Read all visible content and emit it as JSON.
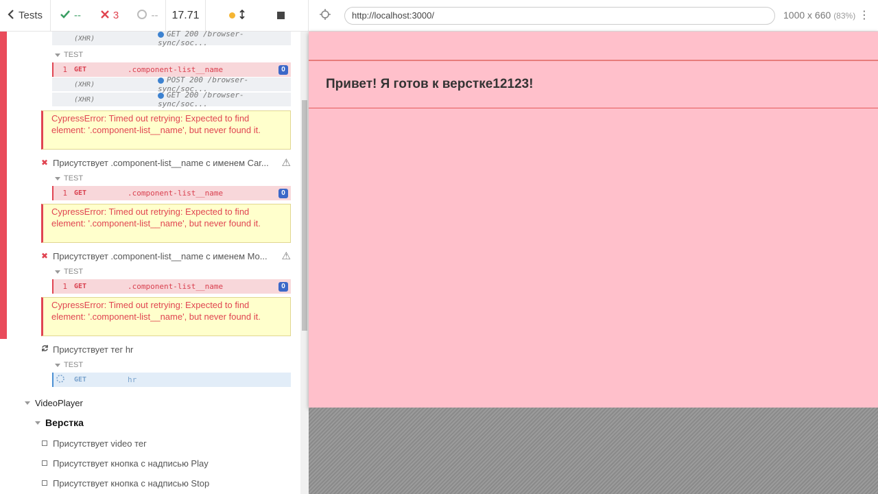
{
  "toolbar": {
    "tests_label": "Tests",
    "passed": "--",
    "failed": "3",
    "pending": "--",
    "duration": "17.71"
  },
  "commands": {
    "xhr1": {
      "type": "(XHR)",
      "msg": "GET 200 /browser-sync/soc..."
    },
    "hook1": "TEST",
    "get1": {
      "num": "1",
      "name": "GET",
      "msg": ".component-list__name",
      "count": "0"
    },
    "xhr2": {
      "type": "(XHR)",
      "msg": "POST 200 /browser-sync/soc..."
    },
    "xhr3": {
      "type": "(XHR)",
      "msg": "GET 200 /browser-sync/soc..."
    },
    "error1": "CypressError: Timed out retrying: Expected to find element: '.component-list__name', but never found it.",
    "test2": "Присутствует .component-list__name с именем Car...",
    "hook2": "TEST",
    "get2": {
      "num": "1",
      "name": "GET",
      "msg": ".component-list__name",
      "count": "0"
    },
    "error2": "CypressError: Timed out retrying: Expected to find element: '.component-list__name', but never found it.",
    "test3": "Присутствует .component-list__name с именем Mo...",
    "hook3": "TEST",
    "get3": {
      "num": "1",
      "name": "GET",
      "msg": ".component-list__name",
      "count": "0"
    },
    "error3": "CypressError: Timed out retrying: Expected to find element: '.component-list__name', but never found it.",
    "test4": "Присутствует тег hr",
    "hook4": "TEST",
    "get4": {
      "name": "GET",
      "msg": "hr"
    }
  },
  "suites": {
    "video_player": "VideoPlayer",
    "layout": "Верстка",
    "tests": [
      "Присутствует video тег",
      "Присутствует кнопка с надписью Play",
      "Присутствует кнопка с надписью Stop"
    ]
  },
  "aut": {
    "url": "http://localhost:3000/",
    "viewport": "1000 x 660",
    "scale": "(83%)",
    "heading": "Привет! Я готов к верстке12123!"
  },
  "colors": {
    "fail": "#e04451",
    "pass": "#3a9e63",
    "aut_bg": "#ffc0cb",
    "error_bg": "#ffffcc"
  },
  "icons": [
    "chevron-left-icon",
    "check-icon",
    "x-icon",
    "spinner-icon",
    "yellow-dot-icon",
    "resize-icon",
    "stop-icon",
    "crosshair-icon",
    "more-icon",
    "warning-icon",
    "retry-icon",
    "triangle-down-icon",
    "checkbox-icon"
  ]
}
